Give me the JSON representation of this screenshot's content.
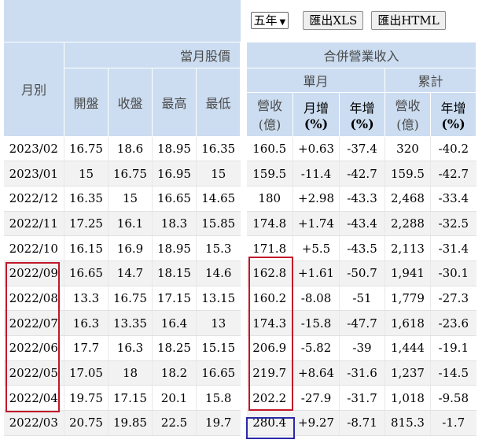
{
  "left": {
    "group_header": "當月股價",
    "month_header": "月別",
    "price_headers": [
      "開盤",
      "收盤",
      "最高",
      "最低"
    ],
    "rows": [
      {
        "month": "2023/02",
        "open": "16.75",
        "close": "18.6",
        "high": "18.95",
        "low": "16.35"
      },
      {
        "month": "2023/01",
        "open": "15",
        "close": "16.75",
        "high": "16.95",
        "low": "15"
      },
      {
        "month": "2022/12",
        "open": "16.35",
        "close": "15",
        "high": "16.65",
        "low": "14.65"
      },
      {
        "month": "2022/11",
        "open": "17.25",
        "close": "16.1",
        "high": "18.3",
        "low": "15.85"
      },
      {
        "month": "2022/10",
        "open": "16.15",
        "close": "16.9",
        "high": "18.95",
        "low": "15.3"
      },
      {
        "month": "2022/09",
        "open": "16.65",
        "close": "14.7",
        "high": "18.15",
        "low": "14.6"
      },
      {
        "month": "2022/08",
        "open": "13.3",
        "close": "16.75",
        "high": "17.15",
        "low": "13.15"
      },
      {
        "month": "2022/07",
        "open": "16.3",
        "close": "13.35",
        "high": "16.4",
        "low": "13"
      },
      {
        "month": "2022/06",
        "open": "17.7",
        "close": "16.3",
        "high": "18.25",
        "low": "15.15"
      },
      {
        "month": "2022/05",
        "open": "17.05",
        "close": "18",
        "high": "18.2",
        "low": "16.65"
      },
      {
        "month": "2022/04",
        "open": "19.75",
        "close": "17.15",
        "high": "20.1",
        "low": "15.8"
      },
      {
        "month": "2022/03",
        "open": "20.75",
        "close": "19.85",
        "high": "22.5",
        "low": "19.7"
      }
    ]
  },
  "right": {
    "toolbar": {
      "period_select": "五年",
      "export_xls": "匯出XLS",
      "export_html": "匯出HTML"
    },
    "group_header": "合併營業收入",
    "monthly_header": "單月",
    "cumulative_header": "累計",
    "col_headers": {
      "revenue": {
        "line1": "營收",
        "line2": "(億)"
      },
      "mom": {
        "line1": "月增",
        "line2": "(%)"
      },
      "yoy": {
        "line1": "年增",
        "line2": "(%)"
      },
      "cum_revenue": {
        "line1": "營收",
        "line2": "(億)"
      },
      "cum_yoy": {
        "line1": "年增",
        "line2": "(%)"
      }
    },
    "rows": [
      {
        "rev": "160.5",
        "mom": "+0.63",
        "yoy": "-37.4",
        "cum": "320",
        "cum_yoy": "-40.2"
      },
      {
        "rev": "159.5",
        "mom": "-11.4",
        "yoy": "-42.7",
        "cum": "159.5",
        "cum_yoy": "-42.7"
      },
      {
        "rev": "180",
        "mom": "+2.98",
        "yoy": "-43.3",
        "cum": "2,468",
        "cum_yoy": "-33.4"
      },
      {
        "rev": "174.8",
        "mom": "+1.74",
        "yoy": "-43.4",
        "cum": "2,288",
        "cum_yoy": "-32.5"
      },
      {
        "rev": "171.8",
        "mom": "+5.5",
        "yoy": "-43.5",
        "cum": "2,113",
        "cum_yoy": "-31.4"
      },
      {
        "rev": "162.8",
        "mom": "+1.61",
        "yoy": "-50.7",
        "cum": "1,941",
        "cum_yoy": "-30.1"
      },
      {
        "rev": "160.2",
        "mom": "-8.08",
        "yoy": "-51",
        "cum": "1,779",
        "cum_yoy": "-27.3"
      },
      {
        "rev": "174.3",
        "mom": "-15.8",
        "yoy": "-47.7",
        "cum": "1,618",
        "cum_yoy": "-23.6"
      },
      {
        "rev": "206.9",
        "mom": "-5.82",
        "yoy": "-39",
        "cum": "1,444",
        "cum_yoy": "-19.1"
      },
      {
        "rev": "219.7",
        "mom": "+8.64",
        "yoy": "-31.6",
        "cum": "1,237",
        "cum_yoy": "-14.5"
      },
      {
        "rev": "202.2",
        "mom": "-27.9",
        "yoy": "-31.7",
        "cum": "1,018",
        "cum_yoy": "-9.58"
      },
      {
        "rev": "280.4",
        "mom": "+9.27",
        "yoy": "-8.71",
        "cum": "815.3",
        "cum_yoy": "-1.7"
      }
    ]
  },
  "colors": {
    "header_bg": "#ccddf1",
    "positive": "#e60012",
    "negative": "#2c8a2c",
    "highlight_red": "#c0182a",
    "highlight_blue": "#2a2aa8"
  }
}
